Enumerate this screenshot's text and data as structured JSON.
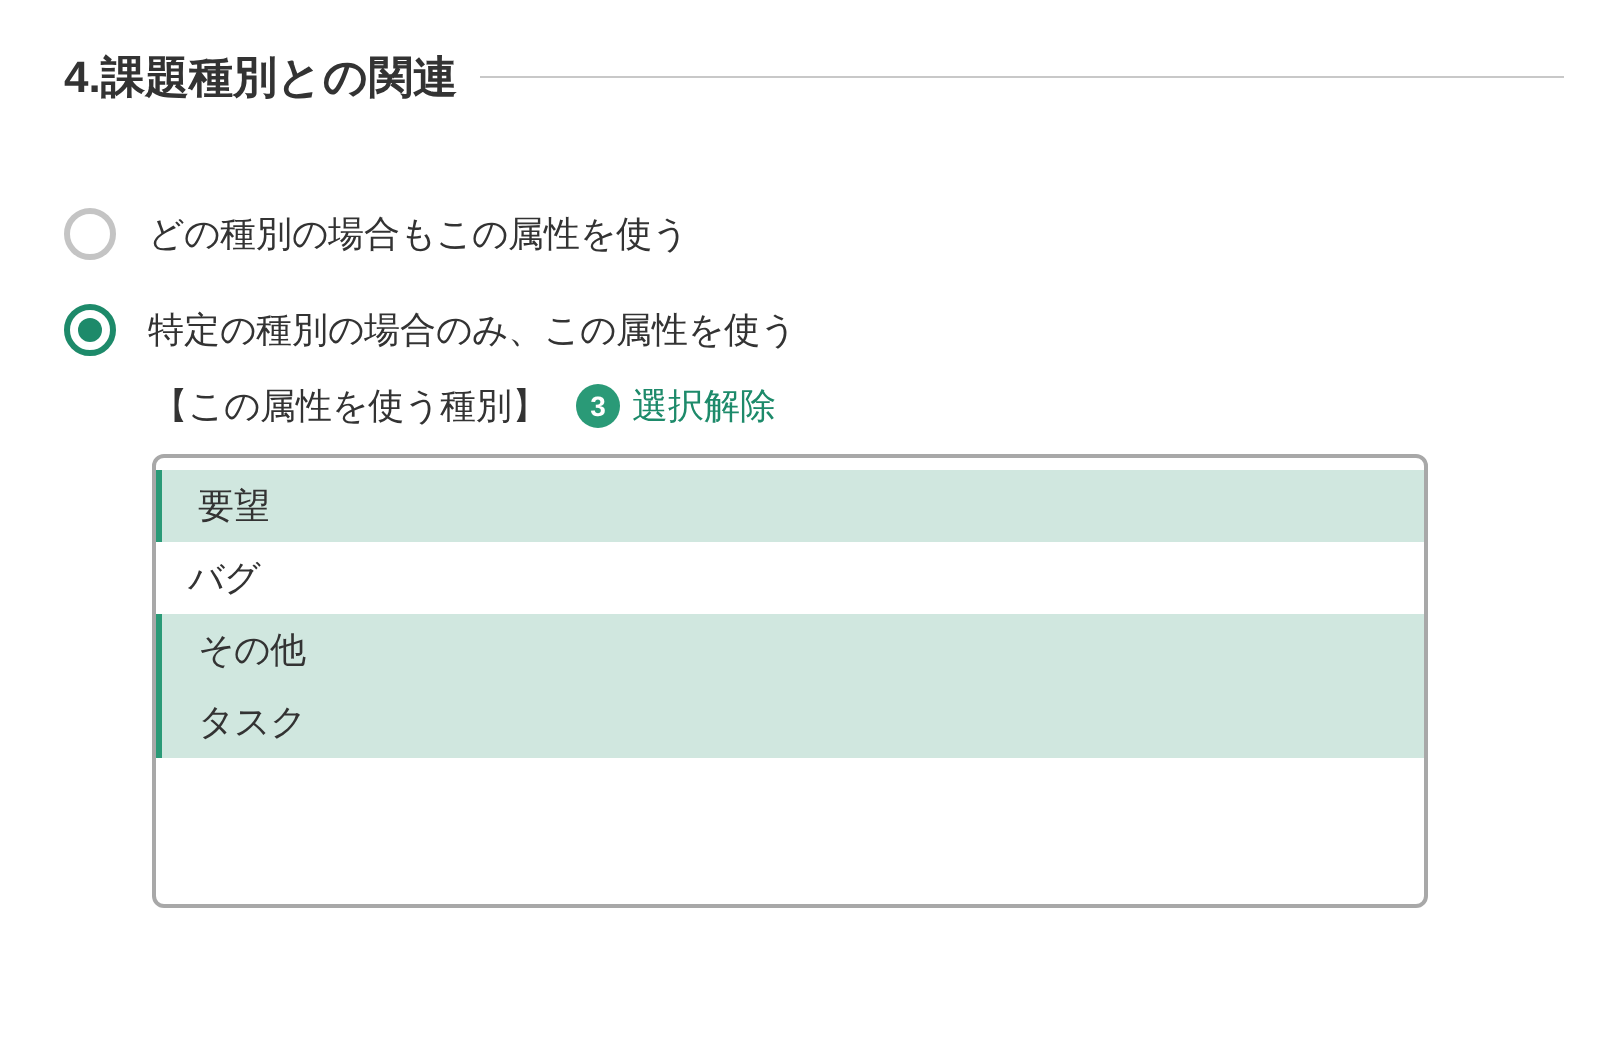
{
  "section": {
    "title": "4.課題種別との関連"
  },
  "options": [
    {
      "label": "どの種別の場合もこの属性を使う",
      "selected": false
    },
    {
      "label": "特定の種別の場合のみ、この属性を使う",
      "selected": true
    }
  ],
  "type_list": {
    "label": "【この属性を使う種別】",
    "count": "3",
    "clear_link": "選択解除",
    "items": [
      {
        "label": "要望",
        "selected": true
      },
      {
        "label": "バグ",
        "selected": false
      },
      {
        "label": "その他",
        "selected": true
      },
      {
        "label": "タスク",
        "selected": true
      }
    ]
  }
}
